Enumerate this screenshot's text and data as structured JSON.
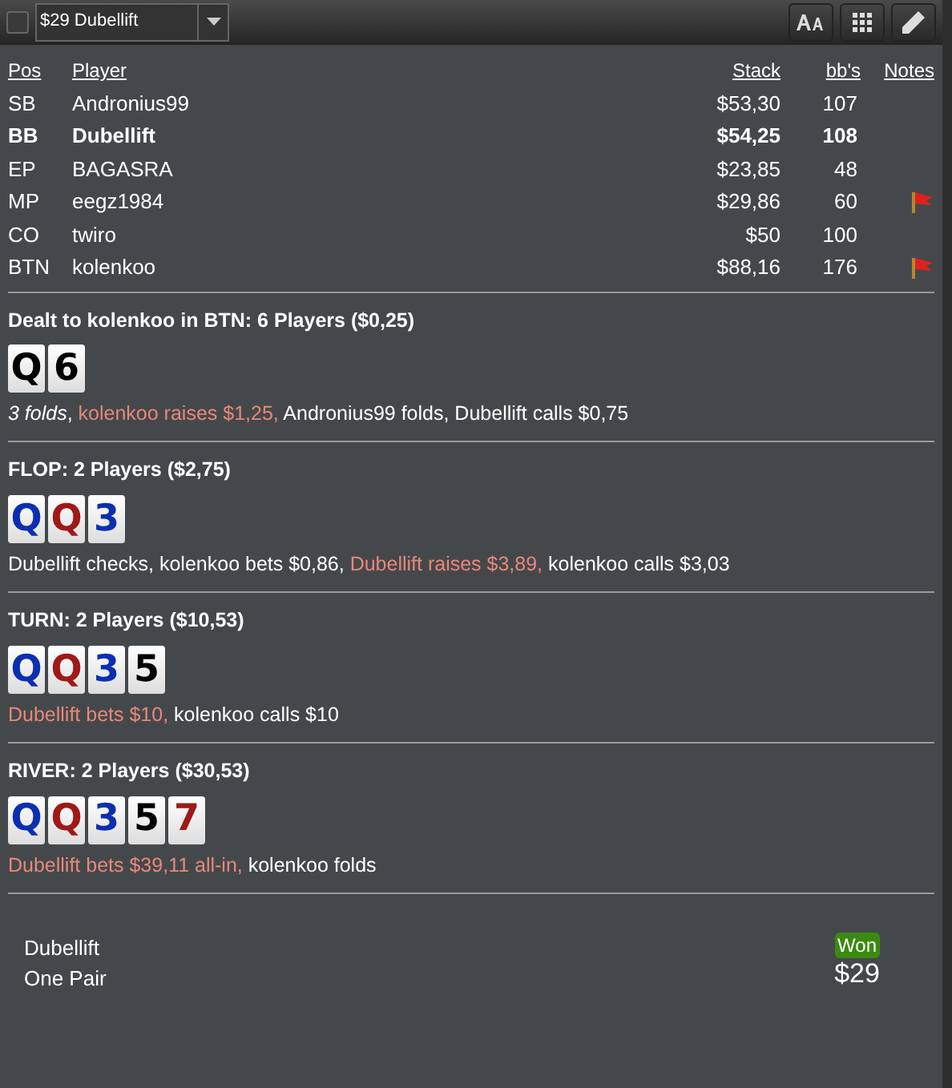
{
  "toolbar": {
    "checkbox": {
      "checked": false
    },
    "hand_select": {
      "value": "$29 Dubellift"
    }
  },
  "players": {
    "columns": [
      "Pos",
      "Player",
      "Stack",
      "bb's",
      "Notes"
    ],
    "rows": [
      {
        "pos": "SB",
        "player": "Andronius99",
        "stack": "$53,30",
        "bbs": "107",
        "hero": false,
        "note": false
      },
      {
        "pos": "BB",
        "player": "Dubellift",
        "stack": "$54,25",
        "bbs": "108",
        "hero": true,
        "note": false
      },
      {
        "pos": "EP",
        "player": "BAGASRA",
        "stack": "$23,85",
        "bbs": "48",
        "hero": false,
        "note": false
      },
      {
        "pos": "MP",
        "player": "eegz1984",
        "stack": "$29,86",
        "bbs": "60",
        "hero": false,
        "note": true
      },
      {
        "pos": "CO",
        "player": "twiro",
        "stack": "$50",
        "bbs": "100",
        "hero": false,
        "note": false
      },
      {
        "pos": "BTN",
        "player": "kolenkoo",
        "stack": "$88,16",
        "bbs": "176",
        "hero": false,
        "note": true
      }
    ]
  },
  "streets": [
    {
      "title": "Dealt to kolenkoo in BTN: 6 Players ($0,25)",
      "cards": [
        {
          "rank": "Q",
          "color": "#000000"
        },
        {
          "rank": "6",
          "color": "#000000"
        }
      ],
      "actions": [
        {
          "text": "3 folds",
          "kind": "summary"
        },
        {
          "text": ", ",
          "kind": "plain"
        },
        {
          "text": "kolenkoo raises $1,25, ",
          "kind": "aggressive"
        },
        {
          "text": "Andronius99 folds, Dubellift calls $0,75",
          "kind": "plain"
        }
      ]
    },
    {
      "title": "FLOP: 2 Players ($2,75)",
      "cards": [
        {
          "rank": "Q",
          "color": "#0b2fb0"
        },
        {
          "rank": "Q",
          "color": "#a01818"
        },
        {
          "rank": "3",
          "color": "#0b2fb0"
        }
      ],
      "actions": [
        {
          "text": "Dubellift checks, kolenkoo bets $0,86, ",
          "kind": "plain"
        },
        {
          "text": "Dubellift raises $3,89, ",
          "kind": "aggressive"
        },
        {
          "text": "kolenkoo calls $3,03",
          "kind": "plain"
        }
      ]
    },
    {
      "title": "TURN: 2 Players ($10,53)",
      "cards": [
        {
          "rank": "Q",
          "color": "#0b2fb0"
        },
        {
          "rank": "Q",
          "color": "#a01818"
        },
        {
          "rank": "3",
          "color": "#0b2fb0"
        },
        {
          "rank": "5",
          "color": "#000000"
        }
      ],
      "actions": [
        {
          "text": "Dubellift bets $10, ",
          "kind": "aggressive"
        },
        {
          "text": "kolenkoo calls $10",
          "kind": "plain"
        }
      ]
    },
    {
      "title": "RIVER: 2 Players ($30,53)",
      "cards": [
        {
          "rank": "Q",
          "color": "#0b2fb0"
        },
        {
          "rank": "Q",
          "color": "#a01818"
        },
        {
          "rank": "3",
          "color": "#0b2fb0"
        },
        {
          "rank": "5",
          "color": "#000000"
        },
        {
          "rank": "7",
          "color": "#a01818"
        }
      ],
      "actions": [
        {
          "text": "Dubellift bets $39,11 all-in, ",
          "kind": "aggressive"
        },
        {
          "text": "kolenkoo folds",
          "kind": "plain"
        }
      ]
    }
  ],
  "result": {
    "player": "Dubellift",
    "hand": "One Pair",
    "badge": "Won",
    "amount": "$29"
  }
}
